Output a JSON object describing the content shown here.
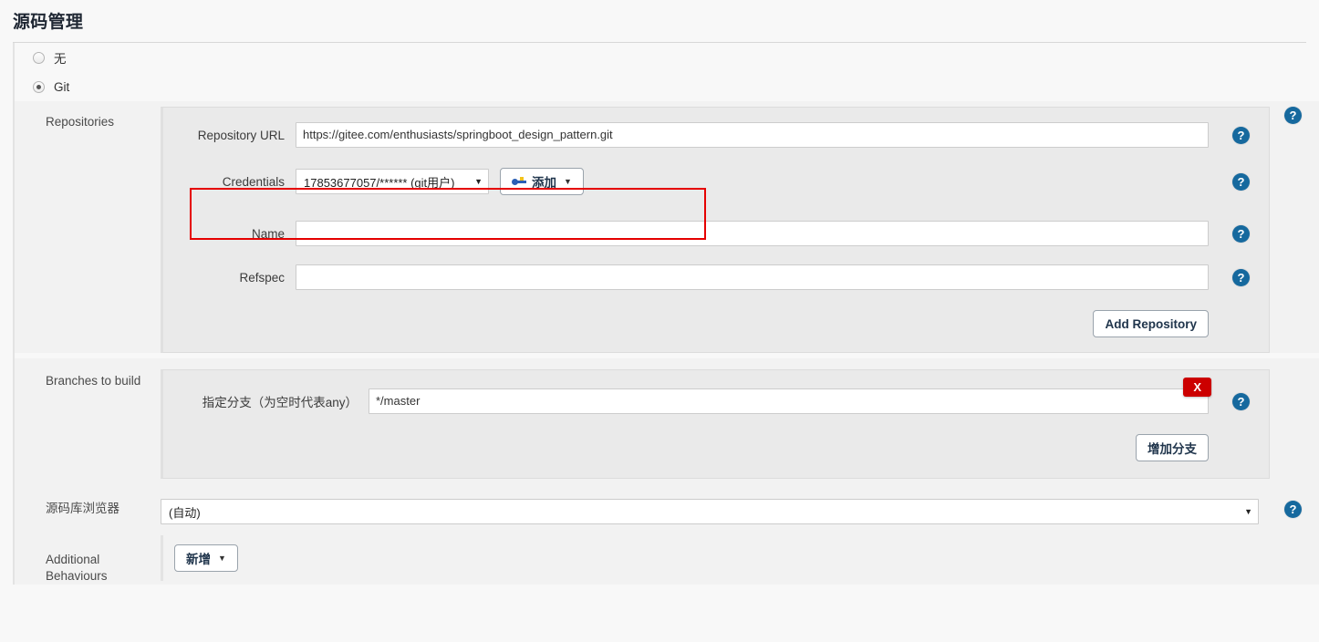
{
  "page": {
    "title": "源码管理"
  },
  "scm_options": [
    {
      "label": "无",
      "selected": false
    },
    {
      "label": "Git",
      "selected": true
    }
  ],
  "sections": {
    "repositories": {
      "label": "Repositories",
      "fields": {
        "repository_url": {
          "label": "Repository URL",
          "value": "https://gitee.com/enthusiasts/springboot_design_pattern.git"
        },
        "credentials": {
          "label": "Credentials",
          "selected": "17853677057/****** (git用户)",
          "add_button": "添加"
        },
        "name": {
          "label": "Name",
          "value": ""
        },
        "refspec": {
          "label": "Refspec",
          "value": ""
        }
      },
      "add_repository_button": "Add Repository"
    },
    "branches": {
      "label": "Branches to build",
      "branch_field": {
        "label": "指定分支（为空时代表any）",
        "value": "*/master"
      },
      "delete_label": "X",
      "add_branch_button": "增加分支"
    },
    "browser": {
      "label": "源码库浏览器",
      "selected": "(自动)"
    },
    "additional": {
      "label": "Additional Behaviours",
      "add_button": "新增"
    }
  },
  "icons": {
    "help": "?",
    "caret_down": "▼"
  },
  "colors": {
    "help_blue": "#16699e",
    "delete_red": "#cc0000",
    "highlight_red": "#e50000",
    "panel_gray": "#eaeaea",
    "row_gray": "#f2f2f2"
  }
}
